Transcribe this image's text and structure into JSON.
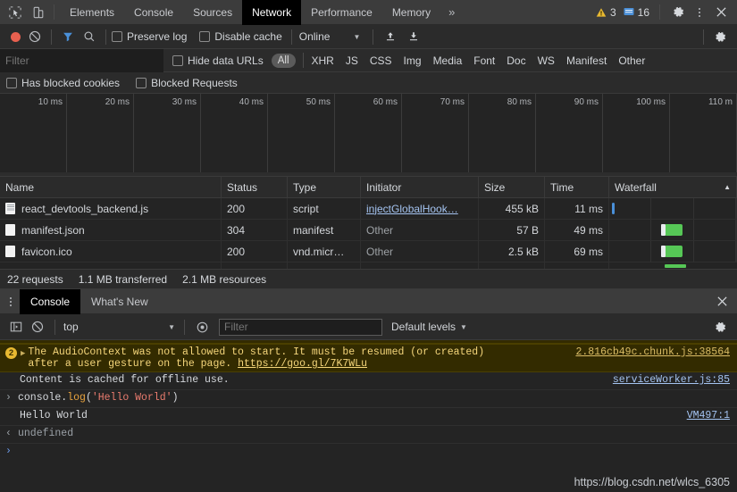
{
  "tabbar": {
    "inspect_icon": "inspect-cursor-icon",
    "device_icon": "device-toggle-icon",
    "tabs": [
      {
        "label": "Elements",
        "active": false
      },
      {
        "label": "Console",
        "active": false
      },
      {
        "label": "Sources",
        "active": false
      },
      {
        "label": "Network",
        "active": true
      },
      {
        "label": "Performance",
        "active": false
      },
      {
        "label": "Memory",
        "active": false
      }
    ],
    "more_label": "»",
    "warning_count": "3",
    "info_count": "16",
    "settings_icon": "gear-icon",
    "menu_icon": "kebab-menu-icon",
    "close_icon": "close-icon"
  },
  "network_toolbar": {
    "record_title": "record-button",
    "clear_title": "clear-button",
    "filter_icon": "funnel-icon",
    "search_icon": "search-icon",
    "preserve_log": "Preserve log",
    "disable_cache": "Disable cache",
    "throttle_value": "Online",
    "import_icon": "upload-har-icon",
    "export_icon": "download-har-icon",
    "settings_icon": "gear-icon"
  },
  "filter_bar": {
    "placeholder": "Filter",
    "value": "",
    "hide_data_urls": "Hide data URLs",
    "types": [
      "All",
      "XHR",
      "JS",
      "CSS",
      "Img",
      "Media",
      "Font",
      "Doc",
      "WS",
      "Manifest",
      "Other"
    ],
    "active_type": "All"
  },
  "blocked_bar": {
    "has_blocked_cookies": "Has blocked cookies",
    "blocked_requests": "Blocked Requests"
  },
  "overview": {
    "ticks": [
      "10 ms",
      "20 ms",
      "30 ms",
      "40 ms",
      "50 ms",
      "60 ms",
      "70 ms",
      "80 ms",
      "90 ms",
      "100 ms",
      "110 m"
    ]
  },
  "requests_table": {
    "columns": [
      "Name",
      "Status",
      "Type",
      "Initiator",
      "Size",
      "Time",
      "Waterfall"
    ],
    "sort_indicator": "▲",
    "rows": [
      {
        "name": "react_devtools_backend.js",
        "status": "200",
        "type": "script",
        "initiator": "injectGlobalHook…",
        "initiator_is_link": true,
        "size": "455 kB",
        "time": "11 ms",
        "bar_kind": "blue",
        "bar_left_pct": 1
      },
      {
        "name": "manifest.json",
        "status": "304",
        "type": "manifest",
        "initiator": "Other",
        "initiator_is_link": false,
        "size": "57 B",
        "time": "49 ms",
        "bar_kind": "green",
        "bar_left_pct": 44
      },
      {
        "name": "favicon.ico",
        "status": "200",
        "type": "vnd.micr…",
        "initiator": "Other",
        "initiator_is_link": false,
        "size": "2.5 kB",
        "time": "69 ms",
        "bar_kind": "green",
        "bar_left_pct": 44
      }
    ]
  },
  "summary": {
    "requests": "22 requests",
    "transferred": "1.1 MB transferred",
    "resources": "2.1 MB resources"
  },
  "drawer": {
    "tabs": [
      {
        "label": "Console",
        "active": true
      },
      {
        "label": "What's New",
        "active": false
      }
    ],
    "close_icon": "close-icon"
  },
  "console_toolbar": {
    "sidebar_icon": "console-sidebar-icon",
    "clear_icon": "clear-console-icon",
    "context_value": "top",
    "eye_icon": "live-expression-icon",
    "filter_placeholder": "Filter",
    "filter_value": "",
    "levels_label": "Default levels",
    "settings_icon": "gear-icon"
  },
  "console_messages": {
    "warning": {
      "badge": "2",
      "line1": "The AudioContext was not allowed to start. It must be resumed (or created)",
      "line2_prefix": "after a user gesture on the page. ",
      "line2_link": "https://goo.gl/7K7WLu",
      "source": "2.816cb49c.chunk.js:38564"
    },
    "info": {
      "text": "Content is cached for offline use.",
      "source": "serviceWorker.js:85"
    },
    "input": {
      "prompt": "›",
      "obj": "console.",
      "fn": "log",
      "open_paren": "(",
      "string": "'Hello World'",
      "close_paren": ")"
    },
    "output": {
      "text": "Hello World",
      "source": "VM497:1"
    },
    "returned": {
      "arrow": "‹",
      "text": "undefined"
    },
    "prompt": "›"
  },
  "watermark": "https://blog.csdn.net/wlcs_6305"
}
